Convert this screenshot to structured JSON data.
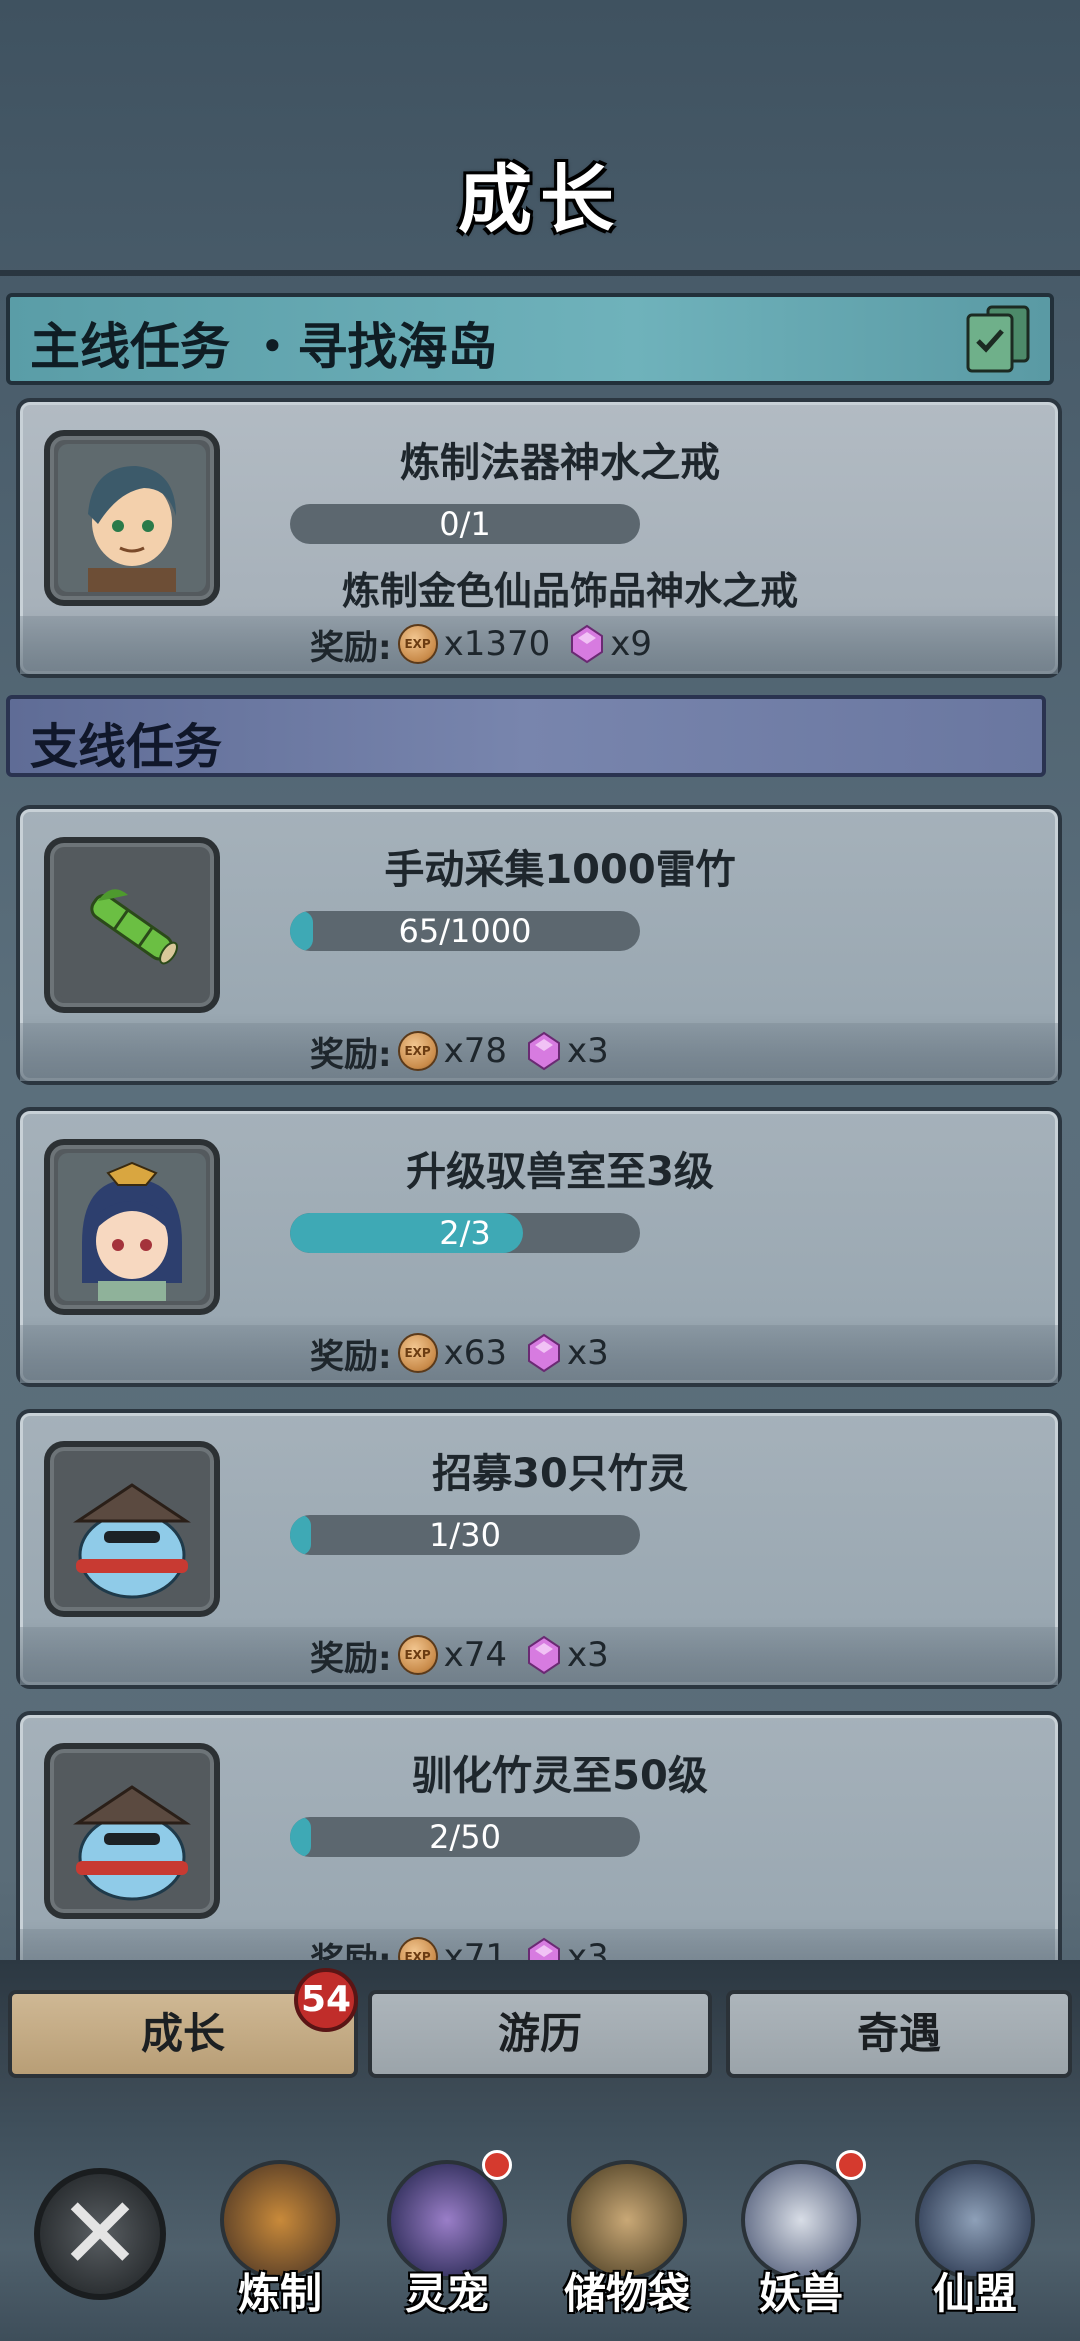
{
  "header": {
    "title": "成长"
  },
  "main_section": {
    "label": "主线任务 ・寻找海岛"
  },
  "side_section": {
    "label": "支线任务"
  },
  "reward_label": "奖励:",
  "main_task": {
    "title": "炼制法器神水之戒",
    "progress_text": "0/1",
    "progress": 0,
    "description": "炼制金色仙品饰品神水之戒",
    "exp": "x1370",
    "gems": "x9"
  },
  "side_tasks": [
    {
      "title": "手动采集1000雷竹",
      "progress_text": "65/1000",
      "progress": 0.065,
      "exp": "x78",
      "gems": "x3"
    },
    {
      "title": "升级驭兽室至3级",
      "progress_text": "2/3",
      "progress": 0.667,
      "exp": "x63",
      "gems": "x3"
    },
    {
      "title": "招募30只竹灵",
      "progress_text": "1/30",
      "progress": 0.033,
      "exp": "x74",
      "gems": "x3"
    },
    {
      "title": "驯化竹灵至50级",
      "progress_text": "2/50",
      "progress": 0.04,
      "exp": "x71",
      "gems": "x3"
    }
  ],
  "tabs": [
    {
      "label": "成长",
      "active": true
    },
    {
      "label": "游历",
      "active": false
    },
    {
      "label": "奇遇",
      "active": false
    }
  ],
  "badge_count": "54",
  "exp_icon_text": "EXP",
  "nav": [
    {
      "label": "炼制",
      "icon": "forge-icon"
    },
    {
      "label": "灵宠",
      "icon": "pet-icon"
    },
    {
      "label": "储物袋",
      "icon": "bag-icon"
    },
    {
      "label": "妖兽",
      "icon": "beast-icon"
    },
    {
      "label": "仙盟",
      "icon": "alliance-icon"
    }
  ],
  "colors": {
    "progress_fill": "#3ea9b5",
    "gem": "#d77be0",
    "tab_active": "#cfb894"
  }
}
